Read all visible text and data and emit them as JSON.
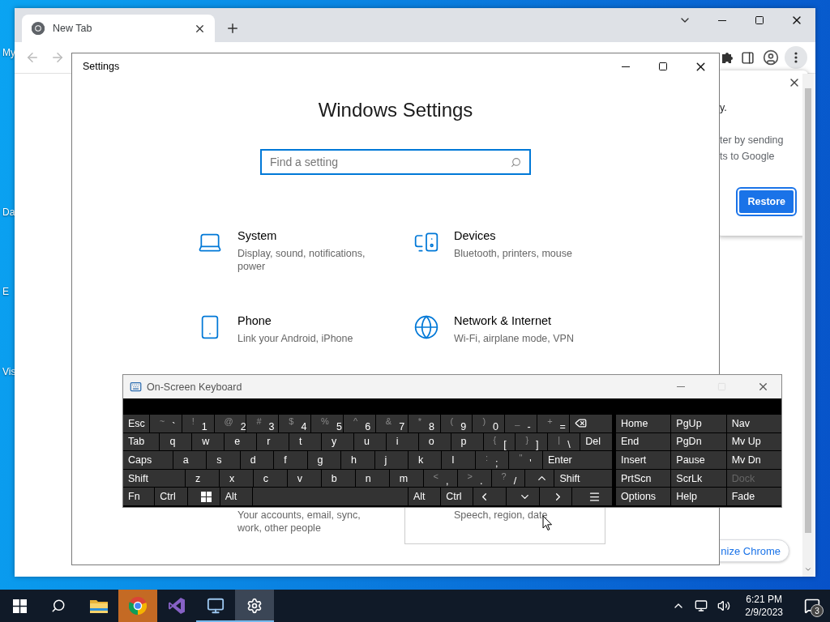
{
  "desktop": {
    "icon_labels": [
      "My",
      "Da",
      "E",
      "Vis"
    ]
  },
  "browser": {
    "tabs": [
      {
        "title": "New Tab",
        "selected": true
      }
    ],
    "popup": {
      "lines": [
        "y.",
        "ter by sending",
        "ts to Google"
      ],
      "button": "Restore"
    },
    "customize_button": "nize Chrome"
  },
  "settings": {
    "title": "Settings",
    "heading": "Windows Settings",
    "search": {
      "placeholder": "Find a setting"
    },
    "tiles": [
      {
        "title": "System",
        "desc": "Display, sound, notifications, power",
        "hovered": false
      },
      {
        "title": "Devices",
        "desc": "Bluetooth, printers, mouse",
        "hovered": false
      },
      {
        "title": "Phone",
        "desc": "Link your Android, iPhone",
        "hovered": false
      },
      {
        "title": "Network & Internet",
        "desc": "Wi-Fi, airplane mode, VPN",
        "hovered": false
      },
      {
        "desc": "Your accounts, email, sync, work, other people",
        "hovered": false
      },
      {
        "desc": "Speech, region, date",
        "hovered": true
      }
    ]
  },
  "keyboard": {
    "title": "On-Screen Keyboard",
    "rows": [
      {
        "keys": [
          {
            "kind": "key",
            "label": "Esc"
          },
          {
            "kind": "key",
            "label": "`",
            "shift": "~"
          },
          {
            "kind": "key",
            "label": "1",
            "shift": "!"
          },
          {
            "kind": "key",
            "label": "2",
            "shift": "@"
          },
          {
            "kind": "key",
            "label": "3",
            "shift": "#"
          },
          {
            "kind": "key",
            "label": "4",
            "shift": "$"
          },
          {
            "kind": "key",
            "label": "5",
            "shift": "%"
          },
          {
            "kind": "key",
            "label": "6",
            "shift": "^"
          },
          {
            "kind": "key",
            "label": "7",
            "shift": "&"
          },
          {
            "kind": "key",
            "label": "8",
            "shift": "*"
          },
          {
            "kind": "key",
            "label": "9",
            "shift": "("
          },
          {
            "kind": "key",
            "label": "0",
            "shift": ")"
          },
          {
            "kind": "key",
            "label": "-",
            "shift": "_"
          },
          {
            "kind": "key",
            "label": "=",
            "shift": "+"
          },
          {
            "kind": "backspace"
          }
        ]
      },
      {
        "keys": [
          {
            "kind": "key",
            "label": "Tab"
          },
          {
            "kind": "key",
            "label": "q"
          },
          {
            "kind": "key",
            "label": "w"
          },
          {
            "kind": "key",
            "label": "e"
          },
          {
            "kind": "key",
            "label": "r"
          },
          {
            "kind": "key",
            "label": "t"
          },
          {
            "kind": "key",
            "label": "y"
          },
          {
            "kind": "key",
            "label": "u"
          },
          {
            "kind": "key",
            "label": "i"
          },
          {
            "kind": "key",
            "label": "o"
          },
          {
            "kind": "key",
            "label": "p"
          },
          {
            "kind": "key",
            "label": "[",
            "shift": "{"
          },
          {
            "kind": "key",
            "label": "]",
            "shift": "}"
          },
          {
            "kind": "key",
            "label": "\\",
            "shift": "|"
          },
          {
            "kind": "key",
            "label": "Del"
          }
        ]
      },
      {
        "keys": [
          {
            "kind": "key",
            "label": "Caps"
          },
          {
            "kind": "key",
            "label": "a"
          },
          {
            "kind": "key",
            "label": "s"
          },
          {
            "kind": "key",
            "label": "d"
          },
          {
            "kind": "key",
            "label": "f"
          },
          {
            "kind": "key",
            "label": "g"
          },
          {
            "kind": "key",
            "label": "h"
          },
          {
            "kind": "key",
            "label": "j"
          },
          {
            "kind": "key",
            "label": "k"
          },
          {
            "kind": "key",
            "label": "l"
          },
          {
            "kind": "key",
            "label": ";",
            "shift": ":"
          },
          {
            "kind": "key",
            "label": "'",
            "shift": "\""
          },
          {
            "kind": "key",
            "label": "Enter"
          }
        ]
      },
      {
        "keys": [
          {
            "kind": "key",
            "label": "Shift"
          },
          {
            "kind": "key",
            "label": "z"
          },
          {
            "kind": "key",
            "label": "x"
          },
          {
            "kind": "key",
            "label": "c"
          },
          {
            "kind": "key",
            "label": "v"
          },
          {
            "kind": "key",
            "label": "b"
          },
          {
            "kind": "key",
            "label": "n"
          },
          {
            "kind": "key",
            "label": "m"
          },
          {
            "kind": "key",
            "label": ",",
            "shift": "<"
          },
          {
            "kind": "key",
            "label": ".",
            "shift": ">"
          },
          {
            "kind": "key",
            "label": "/",
            "shift": "?"
          },
          {
            "kind": "up"
          },
          {
            "kind": "key",
            "label": "Shift"
          }
        ]
      },
      {
        "keys": [
          {
            "kind": "key",
            "label": "Fn"
          },
          {
            "kind": "key",
            "label": "Ctrl"
          },
          {
            "kind": "windows"
          },
          {
            "kind": "key",
            "label": "Alt"
          },
          {
            "kind": "space"
          },
          {
            "kind": "key",
            "label": "Alt"
          },
          {
            "kind": "key",
            "label": "Ctrl"
          },
          {
            "kind": "left"
          },
          {
            "kind": "down"
          },
          {
            "kind": "right"
          },
          {
            "kind": "menu"
          }
        ]
      }
    ],
    "nav": [
      {
        "label": "Home",
        "disabled": false
      },
      {
        "label": "PgUp",
        "disabled": false
      },
      {
        "label": "Nav",
        "disabled": false
      },
      {
        "label": "End",
        "disabled": false
      },
      {
        "label": "PgDn",
        "disabled": false
      },
      {
        "label": "Mv Up",
        "disabled": false
      },
      {
        "label": "Insert",
        "disabled": false
      },
      {
        "label": "Pause",
        "disabled": false
      },
      {
        "label": "Mv Dn",
        "disabled": false
      },
      {
        "label": "PrtScn",
        "disabled": false
      },
      {
        "label": "ScrLk",
        "disabled": false
      },
      {
        "label": "Dock",
        "disabled": true
      },
      {
        "label": "Options",
        "disabled": false
      },
      {
        "label": "Help",
        "disabled": false
      },
      {
        "label": "Fade",
        "disabled": false
      }
    ]
  },
  "taskbar": {
    "apps": [
      {
        "selected": false,
        "running": false,
        "flashing": false
      },
      {
        "selected": false,
        "running": false,
        "flashing": true
      },
      {
        "selected": false,
        "running": false,
        "flashing": false
      },
      {
        "selected": false,
        "running": true,
        "flashing": false
      },
      {
        "selected": true,
        "running": true,
        "flashing": false
      }
    ],
    "clock": {
      "time": "6:21 PM",
      "date": "2/9/2023"
    },
    "notification_count": "3"
  }
}
